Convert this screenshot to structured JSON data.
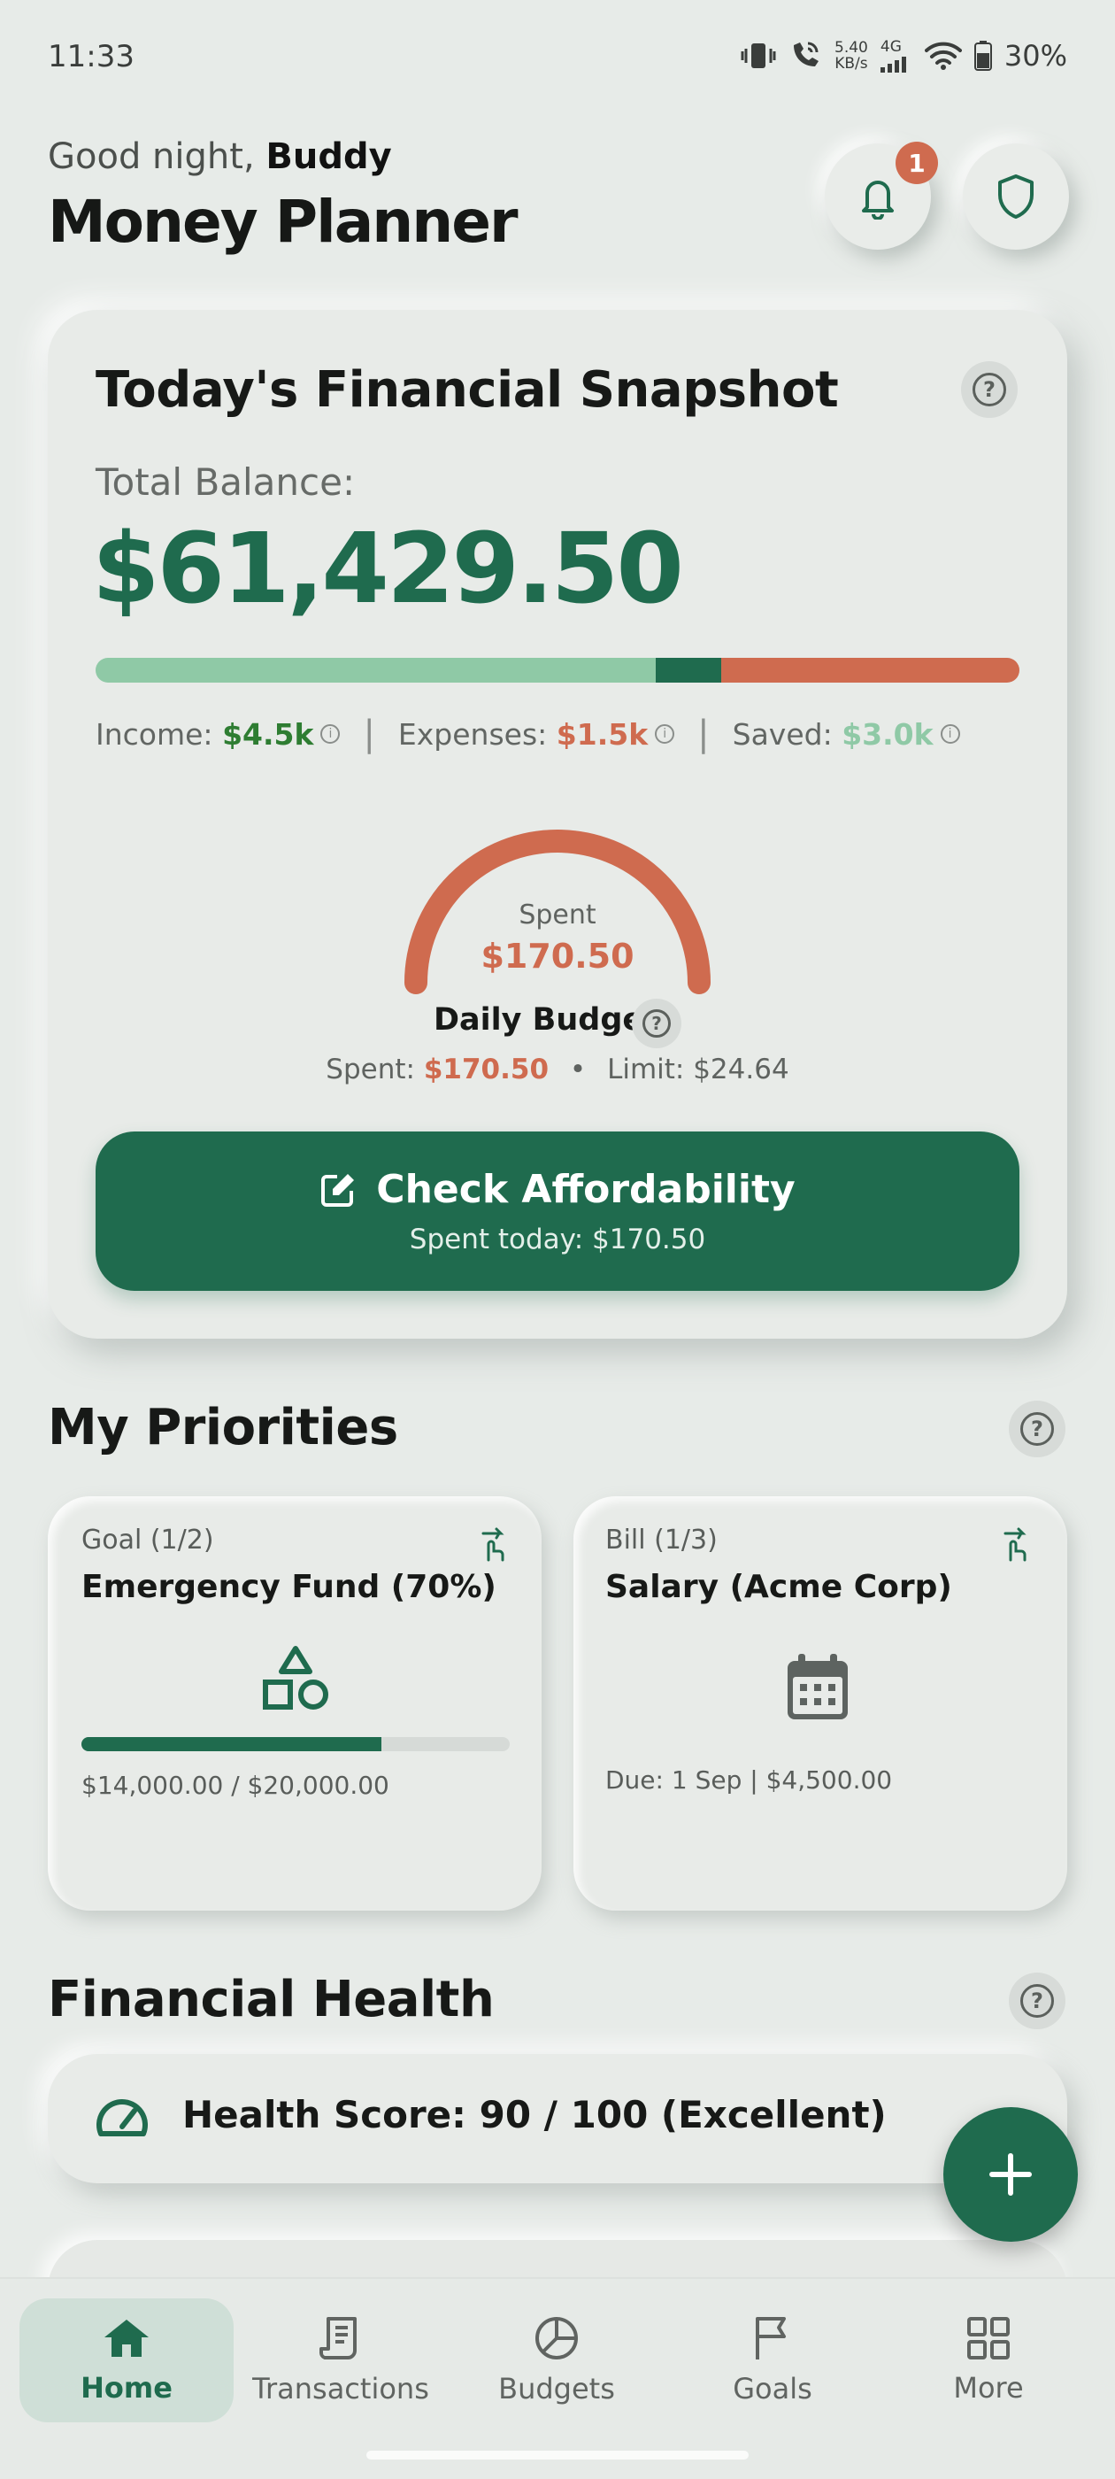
{
  "status_bar": {
    "time": "11:33",
    "net_speed_value": "5.40",
    "net_speed_unit": "KB/s",
    "network": "4G",
    "battery": "30%"
  },
  "header": {
    "greeting_prefix": "Good night,",
    "user_name": "Buddy",
    "title": "Money Planner",
    "notification_count": "1"
  },
  "snapshot": {
    "title": "Today's Financial Snapshot",
    "help_glyph": "?",
    "balance_label": "Total Balance:",
    "balance_value": "$61,429.50",
    "income_label": "Income:",
    "income_value": "$4.5k",
    "expenses_label": "Expenses:",
    "expenses_value": "$1.5k",
    "saved_label": "Saved:",
    "saved_value": "$3.0k",
    "info_glyph": "i",
    "separator": "|",
    "colors": {
      "income": "#2e7d32",
      "expenses": "#cf6b4f",
      "saved": "#8fc9a6",
      "primary": "#1f6b4e"
    },
    "bar_segments": [
      {
        "name": "income",
        "fraction": 0.606,
        "color": "#8fc9a6"
      },
      {
        "name": "saved",
        "fraction": 0.071,
        "color": "#1f6b4e"
      },
      {
        "name": "expenses",
        "fraction": 0.323,
        "color": "#cf6b4f"
      }
    ],
    "gauge": {
      "label": "Spent",
      "value": "$170.50",
      "fill_fraction": 1.0
    },
    "daily_budget": {
      "label": "Daily Budget",
      "spent_label": "Spent:",
      "spent_value": "$170.50",
      "dot": "•",
      "limit_text": "Limit: $24.64"
    },
    "check_button": {
      "label": "Check Affordability",
      "sub": "Spent today: $170.50"
    }
  },
  "priorities": {
    "title": "My Priorities",
    "items": [
      {
        "kind": "Goal (1/2)",
        "title": "Emergency Fund (70%)",
        "icon": "shapes-icon",
        "progress": 0.7,
        "sub": "$14,000.00 / $20,000.00"
      },
      {
        "kind": "Bill (1/3)",
        "title": "Salary (Acme Corp)",
        "icon": "calendar-icon",
        "sub": "Due: 1 Sep | $4,500.00"
      }
    ]
  },
  "health": {
    "title": "Financial Health",
    "score_text": "Health Score: 90 / 100 (Excellent)"
  },
  "fab": {
    "glyph": "+"
  },
  "nav": {
    "items": [
      {
        "label": "Home",
        "icon": "home-icon",
        "active": true
      },
      {
        "label": "Transactions",
        "icon": "receipt-icon"
      },
      {
        "label": "Budgets",
        "icon": "pie-chart-icon"
      },
      {
        "label": "Goals",
        "icon": "flag-icon"
      },
      {
        "label": "More",
        "icon": "grid-icon"
      }
    ]
  }
}
